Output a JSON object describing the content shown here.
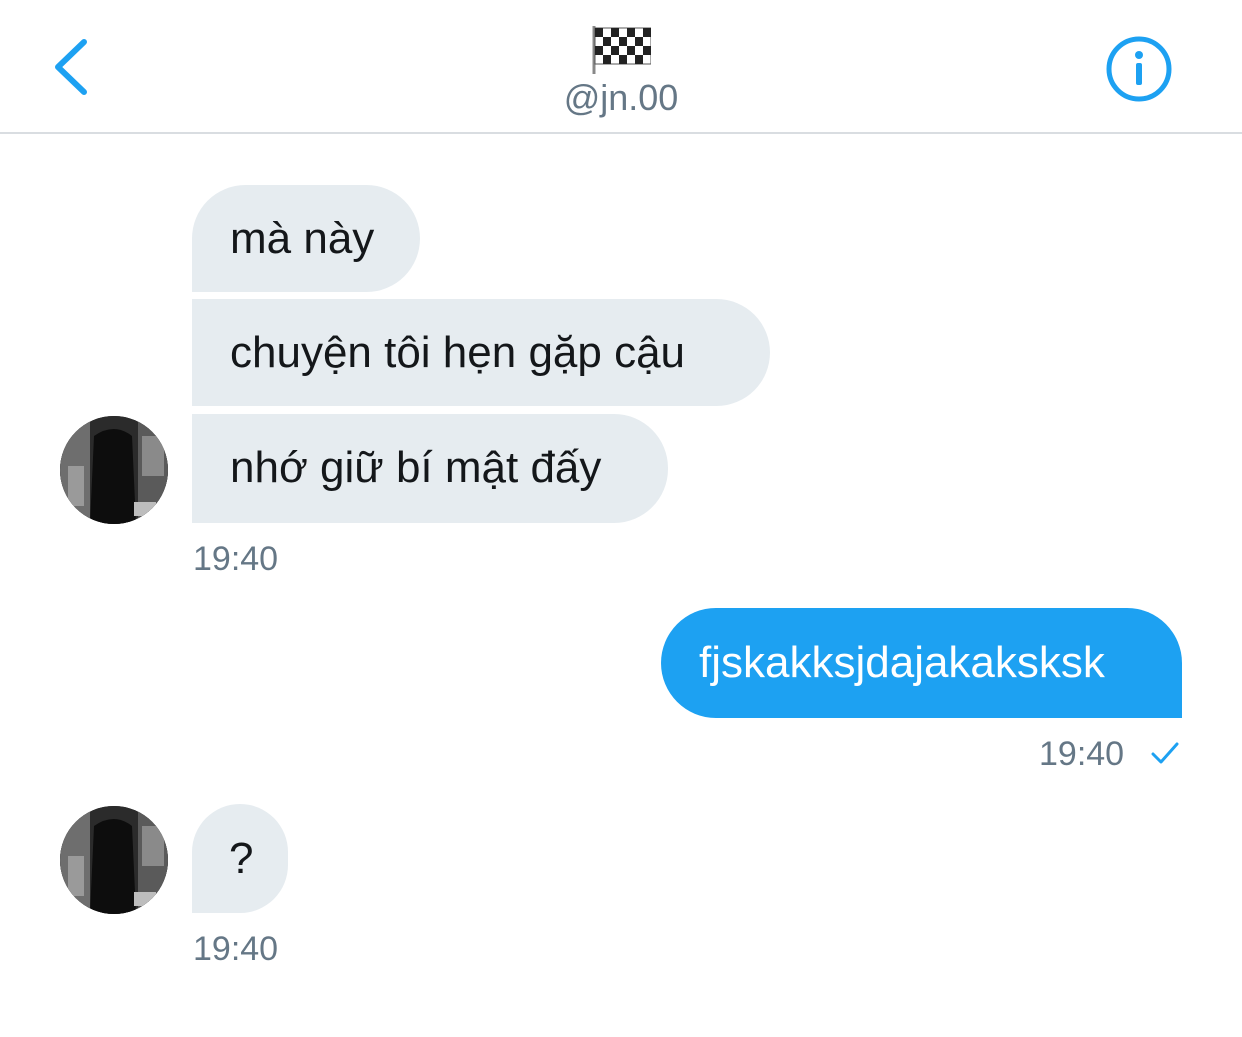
{
  "header": {
    "back_icon": "chevron-left-icon",
    "profile_emoji": "🏁",
    "handle": "@jn.00",
    "info_icon": "info-circle-icon"
  },
  "colors": {
    "accent": "#1da1f2",
    "incoming_bubble": "#e6ecf0",
    "meta_text": "#657786"
  },
  "conversation": {
    "group1": {
      "messages": [
        {
          "text": "mà này"
        },
        {
          "text": "chuyện tôi hẹn gặp cậu"
        },
        {
          "text": "nhớ giữ bí mật đấy"
        }
      ],
      "time": "19:40"
    },
    "sent": {
      "text": "fjskakksjdajakaksksk",
      "time": "19:40",
      "status_icon": "checkmark-icon"
    },
    "group2": {
      "messages": [
        {
          "text": "?"
        }
      ],
      "time": "19:40"
    }
  }
}
